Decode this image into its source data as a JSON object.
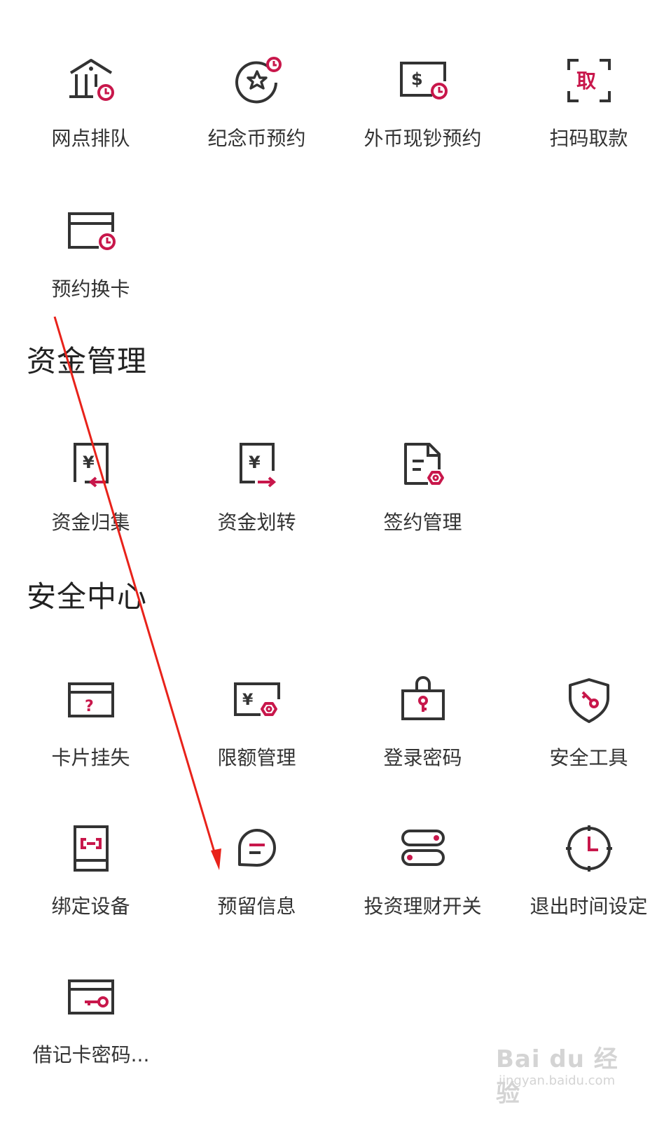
{
  "top_section": {
    "items": [
      {
        "label": "网点排队",
        "icon": "bank-clock-icon"
      },
      {
        "label": "纪念币预约",
        "icon": "star-coin-clock-icon"
      },
      {
        "label": "外币现钞预约",
        "icon": "dollar-note-clock-icon"
      },
      {
        "label": "扫码取款",
        "icon": "scan-withdraw-icon"
      },
      {
        "label": "预约换卡",
        "icon": "card-clock-icon"
      }
    ]
  },
  "fund_management": {
    "title": "资金管理",
    "items": [
      {
        "label": "资金归集",
        "icon": "yuan-collect-icon"
      },
      {
        "label": "资金划转",
        "icon": "yuan-transfer-icon"
      },
      {
        "label": "签约管理",
        "icon": "contract-gear-icon"
      }
    ]
  },
  "security_center": {
    "title": "安全中心",
    "items": [
      {
        "label": "卡片挂失",
        "icon": "card-question-icon"
      },
      {
        "label": "限额管理",
        "icon": "yuan-limit-gear-icon"
      },
      {
        "label": "登录密码",
        "icon": "lock-key-icon"
      },
      {
        "label": "安全工具",
        "icon": "shield-key-icon"
      },
      {
        "label": "绑定设备",
        "icon": "phone-link-icon"
      },
      {
        "label": "预留信息",
        "icon": "chat-bubble-icon"
      },
      {
        "label": "投资理财开关",
        "icon": "toggle-switch-icon"
      },
      {
        "label": "退出时间设定",
        "icon": "clock-icon"
      },
      {
        "label": "借记卡密码...",
        "icon": "card-key-icon"
      }
    ]
  },
  "watermark": {
    "brand": "Bai du 经验",
    "url": "jingyan.baidu.com"
  },
  "colors": {
    "accent": "#c8174b",
    "icon_stroke": "#333333",
    "arrow": "#e8221a"
  }
}
